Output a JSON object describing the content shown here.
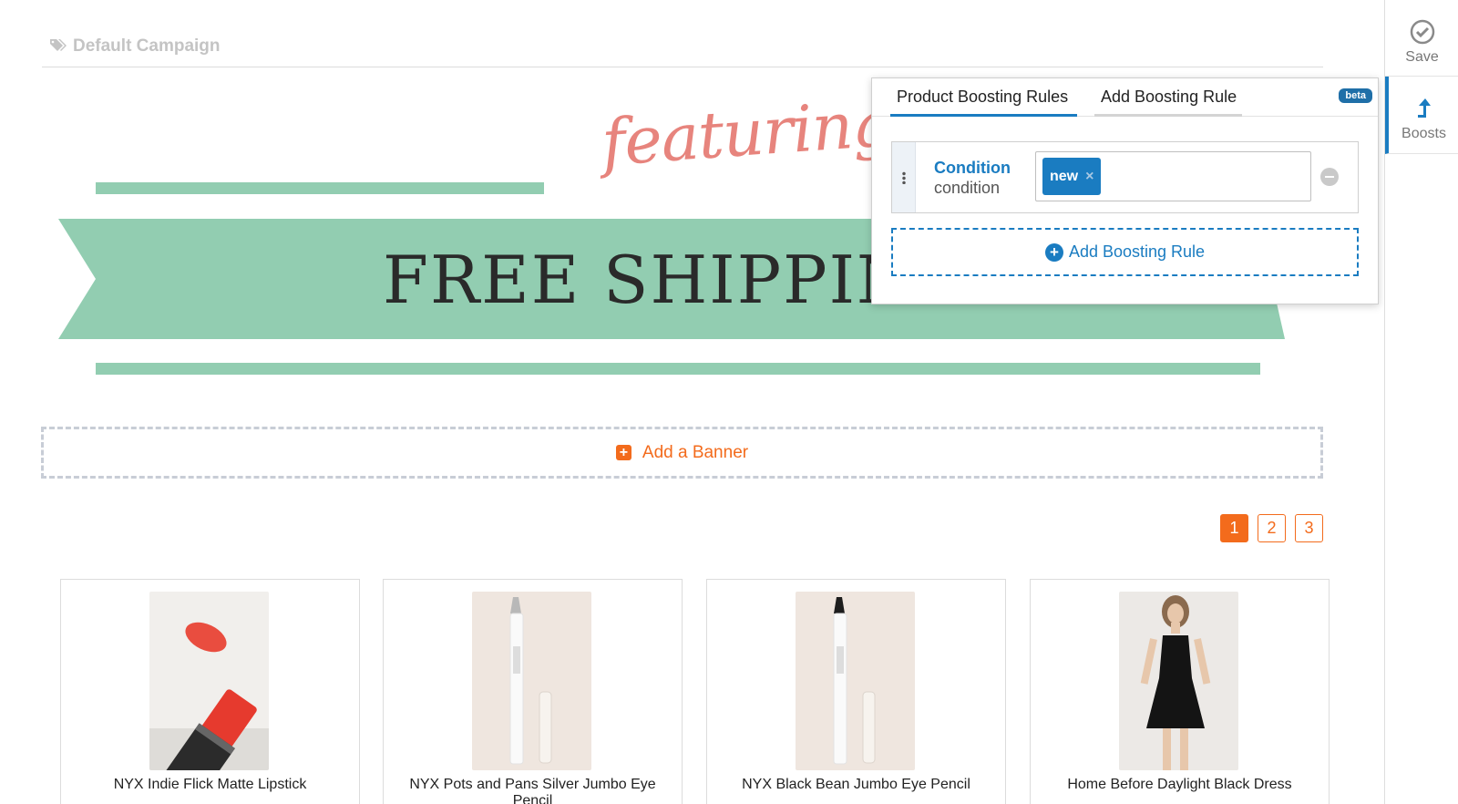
{
  "header": {
    "campaign_title": "Default Campaign",
    "icon": "tags-icon"
  },
  "banner": {
    "script_text": "featuring",
    "headline": "FREE SHIPPING",
    "ribbon_color": "#92cdb1",
    "line_color": "#92cdb1"
  },
  "add_banner": {
    "label": "Add a Banner",
    "icon": "plus-square-icon"
  },
  "pagination": {
    "pages": [
      "1",
      "2",
      "3"
    ],
    "active": "1"
  },
  "products": [
    {
      "name": "NYX Indie Flick Matte Lipstick"
    },
    {
      "name": "NYX Pots and Pans Silver Jumbo Eye Pencil"
    },
    {
      "name": "NYX Black Bean Jumbo Eye Pencil"
    },
    {
      "name": "Home Before Daylight Black Dress"
    }
  ],
  "boost_panel": {
    "tabs": [
      "Product Boosting Rules",
      "Add Boosting Rule"
    ],
    "active_tab": "Product Boosting Rules",
    "badge": "beta",
    "rule": {
      "title": "Condition",
      "subtitle": "condition",
      "chip": "new",
      "chip_remove": "×"
    },
    "add_rule_label": "Add Boosting Rule"
  },
  "sidebar": {
    "save_label": "Save",
    "boosts_label": "Boosts"
  },
  "colors": {
    "accent_orange": "#f36b1c",
    "accent_blue": "#1a7cc1"
  }
}
